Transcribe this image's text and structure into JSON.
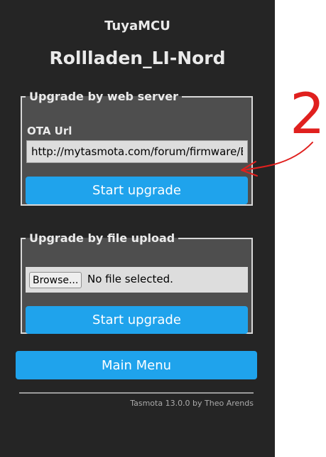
{
  "header": {
    "module": "TuyaMCU",
    "device": "Rollladen_LI-Nord"
  },
  "upgrade_web": {
    "legend": "Upgrade by web server",
    "ota_label": "OTA Url",
    "ota_value": "http://mytasmota.com/forum/firmware/EU",
    "button_label": "Start upgrade"
  },
  "upgrade_file": {
    "legend": "Upgrade by file upload",
    "browse_label": "Browse...",
    "file_status": "No file selected.",
    "button_label": "Start upgrade"
  },
  "main_menu_label": "Main Menu",
  "footer": "Tasmota 13.0.0 by Theo Arends",
  "annotation": {
    "number": "2",
    "color": "#e0201e"
  },
  "colors": {
    "background": "#252525",
    "fieldset": "#4e4e4e",
    "button": "#1fa3ec",
    "input": "#dddddd"
  }
}
